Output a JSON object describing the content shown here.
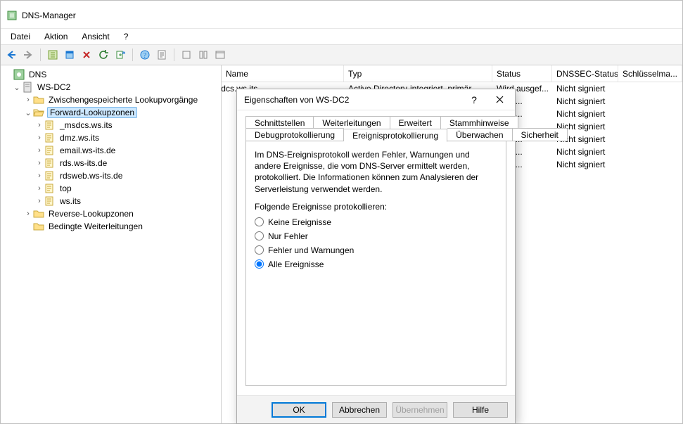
{
  "title": "DNS-Manager",
  "menubar": {
    "datei": "Datei",
    "aktion": "Aktion",
    "ansicht": "Ansicht",
    "help": "?"
  },
  "tree": {
    "root": "DNS",
    "server": "WS-DC2",
    "cached": "Zwischengespeicherte Lookupvorgänge",
    "fwd": "Forward-Lookupzonen",
    "rev": "Reverse-Lookupzonen",
    "cond": "Bedingte Weiterleitungen",
    "zones": [
      "_msdcs.ws.its",
      "dmz.ws.its",
      "email.ws-its.de",
      "rds.ws-its.de",
      "rdsweb.ws-its.de",
      "top",
      "ws.its"
    ]
  },
  "columns": {
    "name": "Name",
    "typ": "Typ",
    "status": "Status",
    "dnssec": "DNSSEC-Status",
    "schl": "Schlüsselma..."
  },
  "rows": [
    {
      "name": "_msdcs.ws.its",
      "typ": "Active Directory-integriert, primär",
      "status": "Wird ausgef...",
      "dnssec": "Nicht signiert"
    },
    {
      "name": "",
      "typ": "",
      "status": "...gef...",
      "dnssec": "Nicht signiert"
    },
    {
      "name": "",
      "typ": "",
      "status": "...gef...",
      "dnssec": "Nicht signiert"
    },
    {
      "name": "",
      "typ": "",
      "status": "...gef...",
      "dnssec": "Nicht signiert"
    },
    {
      "name": "",
      "typ": "",
      "status": "...gef...",
      "dnssec": "Nicht signiert"
    },
    {
      "name": "",
      "typ": "",
      "status": "...gef...",
      "dnssec": "Nicht signiert"
    },
    {
      "name": "",
      "typ": "",
      "status": "...gef...",
      "dnssec": "Nicht signiert"
    }
  ],
  "dialog": {
    "title": "Eigenschaften von WS-DC2",
    "tabs_row1": [
      "Schnittstellen",
      "Weiterleitungen",
      "Erweitert",
      "Stammhinweise"
    ],
    "tabs_row2": [
      "Debugprotokollierung",
      "Ereignisprotokollierung",
      "Überwachen",
      "Sicherheit"
    ],
    "activeTab": "Ereignisprotokollierung",
    "desc": "Im DNS-Ereignisprotokoll werden Fehler, Warnungen und andere Ereignisse, die vom DNS-Server ermittelt werden, protokolliert. Die Informationen können zum Analysieren der Serverleistung verwendet werden.",
    "optlabel": "Folgende Ereignisse protokollieren:",
    "radios": [
      "Keine Ereignisse",
      "Nur Fehler",
      "Fehler und Warnungen",
      "Alle Ereignisse"
    ],
    "selected": "Alle Ereignisse",
    "buttons": {
      "ok": "OK",
      "cancel": "Abbrechen",
      "apply": "Übernehmen",
      "help": "Hilfe"
    }
  }
}
